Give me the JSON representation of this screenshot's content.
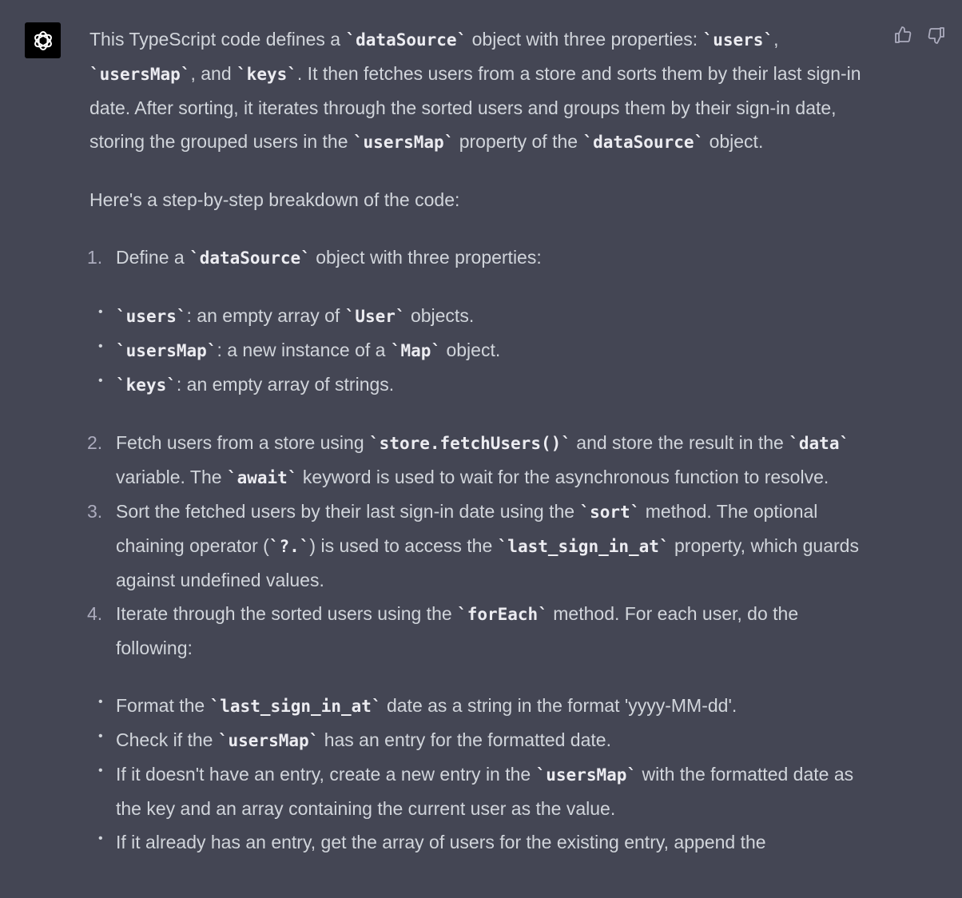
{
  "avatar": {
    "icon": "openai-logo-icon"
  },
  "feedback": {
    "like_icon": "thumbs-up-icon",
    "dislike_icon": "thumbs-down-icon"
  },
  "para1": {
    "t1": "This TypeScript code defines a ",
    "c1": "dataSource",
    "t2": " object with three properties: ",
    "c2": "users",
    "t3": ", ",
    "c3": "usersMap",
    "t4": ", and ",
    "c4": "keys",
    "t5": ". It then fetches users from a store and sorts them by their last sign-in date. After sorting, it iterates through the sorted users and groups them by their sign-in date, storing the grouped users in the ",
    "c5": "usersMap",
    "t6": " property of the ",
    "c6": "dataSource",
    "t7": " object."
  },
  "para2": "Here's a step-by-step breakdown of the code:",
  "step1": {
    "num": "1.",
    "t1": "Define a ",
    "c1": "dataSource",
    "t2": " object with three properties:"
  },
  "step1_bullets": [
    {
      "c1": "users",
      "t1": ": an empty array of ",
      "c2": "User",
      "t2": " objects."
    },
    {
      "c1": "usersMap",
      "t1": ": a new instance of a ",
      "c2": "Map",
      "t2": " object."
    },
    {
      "c1": "keys",
      "t1": ": an empty array of strings."
    }
  ],
  "step2": {
    "num": "2.",
    "t1": "Fetch users from a store using ",
    "c1": "store.fetchUsers()",
    "t2": " and store the result in the ",
    "c2": "data",
    "t3": " variable. The ",
    "c3": "await",
    "t4": " keyword is used to wait for the asynchronous function to resolve."
  },
  "step3": {
    "num": "3.",
    "t1": "Sort the fetched users by their last sign-in date using the ",
    "c1": "sort",
    "t2": " method. The optional chaining operator (",
    "c2": "?.",
    "t3": ") is used to access the ",
    "c3": "last_sign_in_at",
    "t4": " property, which guards against undefined values."
  },
  "step4": {
    "num": "4.",
    "t1": "Iterate through the sorted users using the ",
    "c1": "forEach",
    "t2": " method. For each user, do the following:"
  },
  "step4_bullets": [
    {
      "t1": "Format the ",
      "c1": "last_sign_in_at",
      "t2": " date as a string in the format 'yyyy-MM-dd'."
    },
    {
      "t1": "Check if the ",
      "c1": "usersMap",
      "t2": " has an entry for the formatted date."
    },
    {
      "t1": "If it doesn't have an entry, create a new entry in the ",
      "c1": "usersMap",
      "t2": " with the formatted date as the key and an array containing the current user as the value."
    },
    {
      "t1": "If it already has an entry, get the array of users for the existing entry, append the"
    }
  ]
}
